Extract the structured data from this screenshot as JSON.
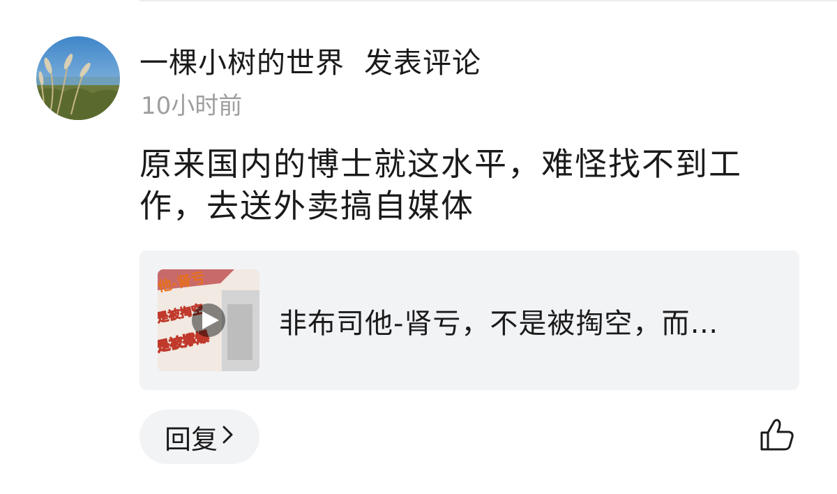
{
  "comment": {
    "username": "一棵小树的世界",
    "action": "发表评论",
    "timestamp": "10小时前",
    "text": "原来国内的博士就这水平，难怪找不到工作，去送外卖搞自媒体"
  },
  "link_card": {
    "title": "非布司他-肾亏，不是被掏空，而…",
    "thumbnail_text": [
      "他-肾亏",
      "是被掏空",
      "是被撑爆"
    ],
    "thumbnail_icon": "play-icon"
  },
  "actions": {
    "reply_label": "回复",
    "reply_icon": "chevron-right-icon",
    "like_icon": "thumbs-up-icon"
  },
  "colors": {
    "card_bg": "#f2f3f5",
    "muted_text": "#9e9e9e",
    "thumb_title_color": "#e8701a"
  }
}
